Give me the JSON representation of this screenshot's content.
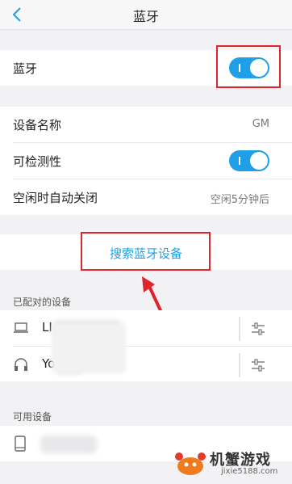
{
  "header": {
    "title": "蓝牙"
  },
  "bluetooth": {
    "label": "蓝牙",
    "enabled": true
  },
  "settings": {
    "device_name_label": "设备名称",
    "device_name_value": "GM",
    "discoverable_label": "可检测性",
    "discoverable_enabled": true,
    "auto_off_label": "空闲时自动关闭",
    "auto_off_value": "空闲5分钟后"
  },
  "search": {
    "label": "搜索蓝牙设备"
  },
  "paired": {
    "section_title": "已配对的设备",
    "devices": [
      {
        "name": "LI",
        "icon": "laptop-icon"
      },
      {
        "name": "Yo",
        "icon": "headphones-icon"
      }
    ]
  },
  "available": {
    "section_title": "可用设备",
    "devices": [
      {
        "icon": "phone-icon"
      }
    ]
  },
  "watermark": {
    "brand": "机蟹游戏",
    "url": "jixie5188.com"
  },
  "colors": {
    "accent": "#1e9fe8",
    "highlight": "#e0242b"
  }
}
